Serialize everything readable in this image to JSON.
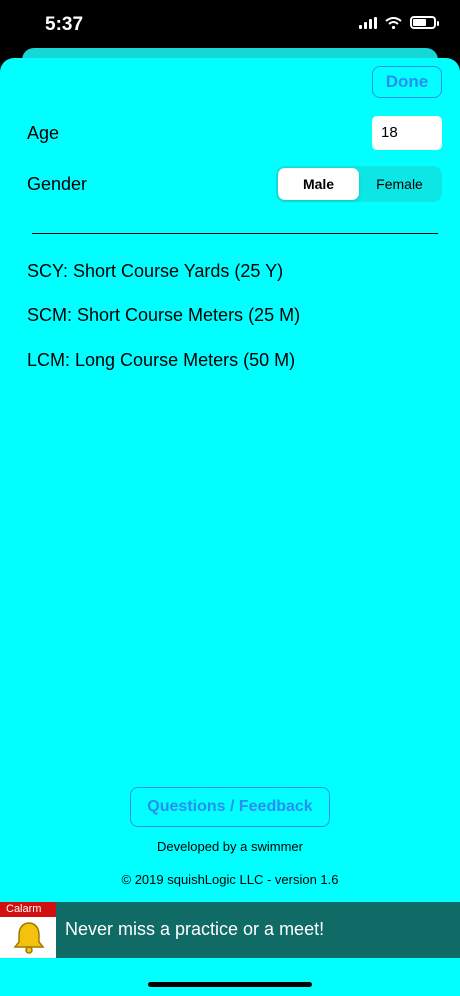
{
  "status_bar": {
    "time": "5:37",
    "wifi_icon": "wifi-icon",
    "battery_level": 0.65
  },
  "toolbar": {
    "done_label": "Done"
  },
  "settings": {
    "age_label": "Age",
    "age_value": "18",
    "gender_label": "Gender",
    "gender_options": [
      "Male",
      "Female"
    ],
    "gender_selected": "Male"
  },
  "courses": [
    "SCY: Short Course Yards (25 Y)",
    "SCM: Short Course Meters (25 M)",
    "LCM: Long Course Meters (50 M)"
  ],
  "footer": {
    "feedback_label": "Questions / Feedback",
    "developer_note": "Developed by a swimmer",
    "copyright": "© 2019 squishLogic LLC - version 1.6"
  },
  "banner": {
    "app_tag": "Calarm",
    "icon": "bell-icon",
    "text": "Never miss a practice or a meet!"
  },
  "colors": {
    "background": "#00ffff",
    "accent": "#2a8ef0",
    "banner": "#106b66",
    "banner_tag": "#d01010"
  }
}
